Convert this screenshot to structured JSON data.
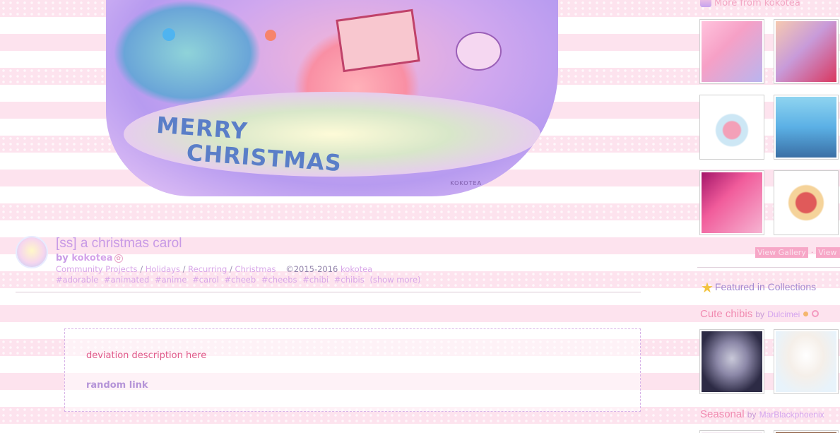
{
  "artwork": {
    "greeting_line1": "MERRY",
    "greeting_line2": "CHRISTMAS",
    "signature": "KOKOTEA"
  },
  "deviation": {
    "title": "[ss] a christmas carol",
    "by_label": "by",
    "author": "kokotea",
    "categories": [
      "Community Projects",
      "Holidays",
      "Recurring",
      "Christmas"
    ],
    "category_separator": "/",
    "copyright": "©2015-2016",
    "copyright_owner": "kokotea",
    "tags": [
      "#adorable",
      "#animated",
      "#anime",
      "#carol",
      "#cheeb",
      "#cheebs",
      "#chibi",
      "#chibis"
    ],
    "show_more": "(show more)"
  },
  "description": {
    "text": "deviation description here",
    "link": "random link"
  },
  "sidebar": {
    "more_from_label": "More from kokotea",
    "view_gallery": "View Gallery",
    "view_more": "View M",
    "featured_label": "Featured in Collections",
    "collections": [
      {
        "name": "Cute chibis",
        "by": "by",
        "user": "Dulcimei"
      },
      {
        "name": "Seasonal",
        "by": "by",
        "user": "MarBlackphoenix"
      }
    ]
  },
  "colors": {
    "stripe_pink": "#fde3ee",
    "title_purple": "#c89ae6",
    "description_pink": "#e05a8a",
    "star_gold": "#f2c33d"
  }
}
